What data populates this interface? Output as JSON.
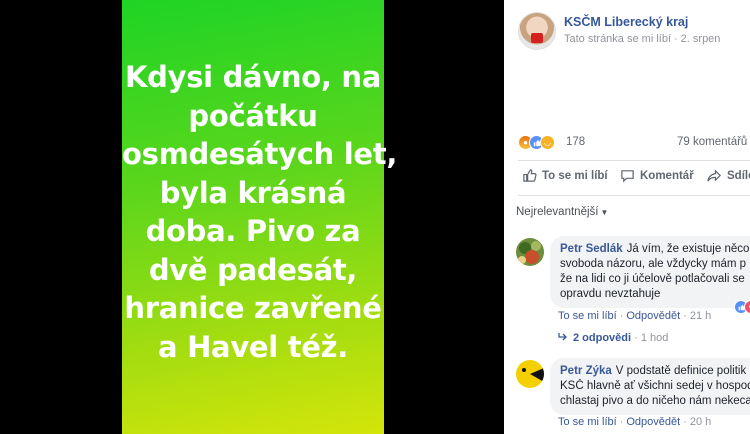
{
  "photo": {
    "lines": [
      "Kdysi dávno, na",
      "počátku",
      "osmdesátych let,",
      "byla krásná",
      "doba. Pivo za",
      "dvě padesát,",
      "hranice zavřené",
      "a Havel též."
    ]
  },
  "post": {
    "page_name": "KSČM Liberecký kraj",
    "like_status": "Tato stránka se mi líbí",
    "date": "2. srpen",
    "reaction_count": "178",
    "comments_count": "79 komentářů",
    "actions": {
      "like": "To se mi líbí",
      "comment": "Komentář",
      "share": "Sdílet"
    },
    "sort_label": "Nejrelevantnější"
  },
  "comments": [
    {
      "author": "Petr Sedlák",
      "lines": [
        "Já vím, že existuje něco",
        "svoboda názoru, ale vždycky mám p",
        "že na lidi co ji účelově potlačovali se",
        "opravdu nevztahuje"
      ],
      "like_label": "To se mi líbí",
      "reply_label": "Odpovědět",
      "time": "21 h"
    },
    {
      "author": "Petr Zýka",
      "lines": [
        "V podstatě definice politik",
        "KSČ hlavně ať všichni sedej v hospod",
        "chlastaj pivo a do ničeho nám nekeca"
      ],
      "like_label": "To se mi líbí",
      "reply_label": "Odpovědět",
      "time": "20 h"
    }
  ],
  "replies": {
    "label": "2 odpovědi",
    "time": "1 hod"
  },
  "colors": {
    "link": "#385898",
    "muted": "#90949c",
    "photo_top": "#1ed425",
    "photo_bottom": "#d4e50a"
  }
}
